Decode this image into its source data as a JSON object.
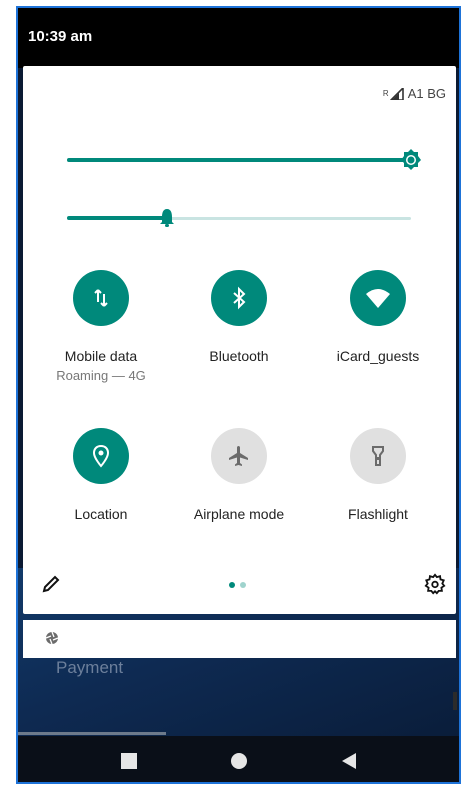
{
  "status_bar": {
    "time": "10:39 am"
  },
  "network": {
    "roaming_indicator": "R",
    "carrier": "A1 BG"
  },
  "sliders": {
    "brightness": 1.0,
    "volume": 0.29
  },
  "tiles": [
    {
      "label": "Mobile data",
      "sublabel": "Roaming — 4G",
      "icon": "mobile-data-icon",
      "active": true
    },
    {
      "label": "Bluetooth",
      "sublabel": "",
      "icon": "bluetooth-icon",
      "active": true
    },
    {
      "label": "iCard_guests",
      "sublabel": "",
      "icon": "wifi-icon",
      "active": true
    },
    {
      "label": "Location",
      "sublabel": "",
      "icon": "location-icon",
      "active": true
    },
    {
      "label": "Airplane mode",
      "sublabel": "",
      "icon": "airplane-icon",
      "active": false
    },
    {
      "label": "Flashlight",
      "sublabel": "",
      "icon": "flashlight-icon",
      "active": false
    }
  ],
  "pager": {
    "pages": 2,
    "current": 1
  },
  "background_app": {
    "text": "Payment"
  },
  "colors": {
    "accent": "#00897b",
    "inactive_tile": "#e0e0e0",
    "track": "#c9e4e2"
  },
  "nav": {
    "buttons": [
      "recents",
      "home",
      "back"
    ]
  }
}
